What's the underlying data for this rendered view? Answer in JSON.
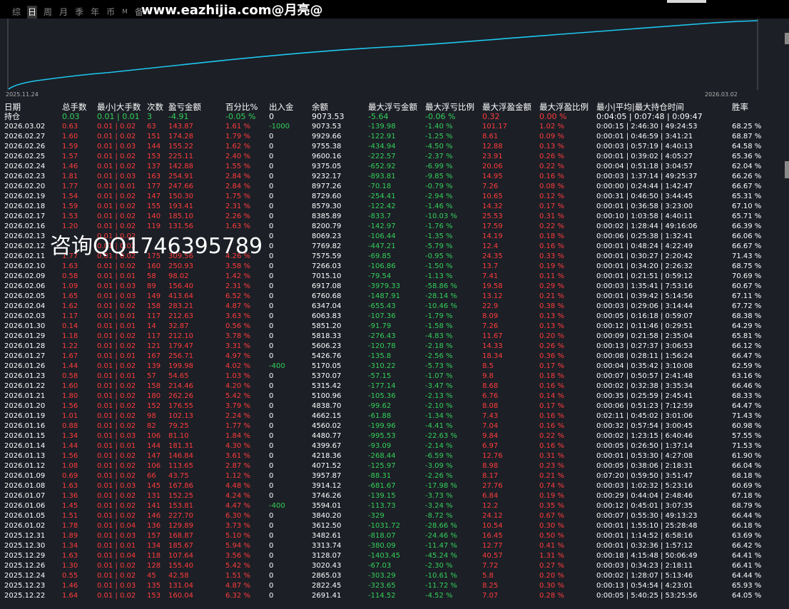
{
  "toolbar": {
    "tabs": [
      {
        "label": "综",
        "active": false
      },
      {
        "label": "日",
        "active": true
      },
      {
        "label": "周",
        "active": false
      },
      {
        "label": "月",
        "active": false
      },
      {
        "label": "季",
        "active": false
      },
      {
        "label": "年",
        "active": false
      },
      {
        "label": "币",
        "active": false
      },
      {
        "label": "M",
        "active": false,
        "small": true
      },
      {
        "label": "备",
        "active": false
      }
    ],
    "watermark": "www.eazhijia.com@月亮@"
  },
  "chart": {
    "start_date": "2025.11.24",
    "end_date": "2026.03.02",
    "line_color": "#1ec8f0"
  },
  "chart_data": {
    "type": "line",
    "x": [
      "2025.11.24",
      "2026.03.02"
    ],
    "series": [
      {
        "values": []
      }
    ]
  },
  "table": {
    "headers": {
      "date": "日期",
      "total": "总手数",
      "minmax": "最小|大手数",
      "count": "次数",
      "pl": "盈亏金额",
      "pct": "百分比%",
      "io": "出入金",
      "bal": "余额",
      "mdd": "最大浮亏金额",
      "mddp": "最大浮亏比例",
      "mfp": "最大浮盈金额",
      "mfpp": "最大浮盈比例",
      "time": "最小|平均|最大持仓时间",
      "win": "胜率"
    },
    "holding": {
      "date": "持仓",
      "total": "0.03",
      "minmax": "0.01 | 0.01",
      "count": "3",
      "pl": "-4.91",
      "pct": "-0.05 %",
      "io": "0",
      "bal": "9073.53",
      "mdd": "-5.64",
      "mddp": "-0.06 %",
      "mfp": "0.32",
      "mfpp": "0.00 %",
      "time": "0:04:05 | 0:07:48 | 0:09:47",
      "win": ""
    },
    "rows": [
      [
        "2026.03.02",
        "0.63",
        "0.01 | 0.02",
        "63",
        "143.87",
        "1.61 %",
        "-1000",
        "9073.53",
        "-139.98",
        "-1.40 %",
        "101.17",
        "1.02 %",
        "0:00:15 | 2:46:30 | 49:24:53",
        "68.25 %"
      ],
      [
        "2026.02.27",
        "1.60",
        "0.01 | 0.02",
        "151",
        "174.28",
        "1.79 %",
        "0",
        "9929.66",
        "-122.91",
        "-1.25 %",
        "8.61",
        "0.09 %",
        "0:00:01 | 0:46:59 | 3:41:21",
        "68.87 %"
      ],
      [
        "2026.02.26",
        "1.59",
        "0.01 | 0.03",
        "144",
        "155.22",
        "1.62 %",
        "0",
        "9755.38",
        "-434.94",
        "-4.50 %",
        "12.88",
        "0.13 %",
        "0:00:03 | 0:57:19 | 4:40:13",
        "64.58 %"
      ],
      [
        "2026.02.25",
        "1.57",
        "0.01 | 0.02",
        "153",
        "225.11",
        "2.40 %",
        "0",
        "9600.16",
        "-222.57",
        "-2.37 %",
        "23.91",
        "0.26 %",
        "0:00:01 | 0:39:02 | 4:05:27",
        "65.36 %"
      ],
      [
        "2026.02.24",
        "1.46",
        "0.01 | 0.02",
        "137",
        "142.88",
        "1.55 %",
        "0",
        "9375.05",
        "-652.92",
        "-6.99 %",
        "20.06",
        "0.22 %",
        "0:00:04 | 0:51:18 | 3:04:57",
        "62.04 %"
      ],
      [
        "2026.02.23",
        "1.81",
        "0.01 | 0.03",
        "163",
        "254.91",
        "2.84 %",
        "0",
        "9232.17",
        "-893.81",
        "-9.85 %",
        "14.95",
        "0.16 %",
        "0:00:03 | 1:37:14 | 49:25:37",
        "66.26 %"
      ],
      [
        "2026.02.20",
        "1.77",
        "0.01 | 0.01",
        "177",
        "247.66",
        "2.84 %",
        "0",
        "8977.26",
        "-70.18",
        "-0.79 %",
        "7.26",
        "0.08 %",
        "0:00:00 | 0:24:44 | 1:42:47",
        "66.67 %"
      ],
      [
        "2026.02.19",
        "1.54",
        "0.01 | 0.02",
        "147",
        "150.30",
        "1.75 %",
        "0",
        "8729.60",
        "-254.41",
        "-2.94 %",
        "10.65",
        "0.12 %",
        "0:00:31 | 0:46:50 | 3:44:45",
        "65.31 %"
      ],
      [
        "2026.02.18",
        "1.59",
        "0.01 | 0.02",
        "155",
        "193.41",
        "2.31 %",
        "0",
        "8579.30",
        "-122.42",
        "-1.46 %",
        "14.32",
        "0.17 %",
        "0:00:01 | 0:36:58 | 3:23:00",
        "67.10 %"
      ],
      [
        "2026.02.17",
        "1.53",
        "0.01 | 0.02",
        "140",
        "185.10",
        "2.26 %",
        "0",
        "8385.89",
        "-833.7",
        "-10.03 %",
        "25.53",
        "0.31 %",
        "0:00:10 | 1:03:58 | 4:40:11",
        "65.71 %"
      ],
      [
        "2026.02.16",
        "1.20",
        "0.01 | 0.02",
        "119",
        "131.56",
        "1.63 %",
        "0",
        "8200.79",
        "-142.97",
        "-1.76 %",
        "17.59",
        "0.22 %",
        "0:00:02 | 1:28:44 | 49:16:06",
        "66.39 %"
      ],
      [
        "2026.02.13",
        "",
        "0.01 | 0.02",
        "",
        "",
        "",
        "0",
        "8069.23",
        "-106.44",
        "-1.35 %",
        "14.19",
        "0.18 %",
        "0:00:06 | 0:25:38 | 1:32:41",
        "66.06 %"
      ],
      [
        "2026.02.12",
        "",
        "0.01 | 0.02",
        "",
        "",
        "",
        "0",
        "7769.82",
        "-447.21",
        "-5.79 %",
        "12.4",
        "0.16 %",
        "0:00:01 | 0:48:24 | 4:22:49",
        "66.67 %"
      ],
      [
        "2026.02.11",
        "1.77",
        "0.01 | 0.02",
        "175",
        "309.56",
        "4.26 %",
        "0",
        "7575.59",
        "-69.85",
        "-0.95 %",
        "24.35",
        "0.33 %",
        "0:00:01 | 0:30:27 | 2:20:42",
        "71.43 %"
      ],
      [
        "2026.02.10",
        "1.63",
        "0.01 | 0.02",
        "160",
        "250.93",
        "3.58 %",
        "0",
        "7266.03",
        "-106.86",
        "-1.50 %",
        "13.7",
        "0.19 %",
        "0:00:01 | 0:34:20 | 2:26:32",
        "68.75 %"
      ],
      [
        "2026.02.09",
        "0.58",
        "0.01 | 0.01",
        "58",
        "98.02",
        "1.42 %",
        "0",
        "7015.10",
        "-79.54",
        "-1.13 %",
        "7.41",
        "0.11 %",
        "0:00:01 | 0:21:51 | 0:59:12",
        "70.69 %"
      ],
      [
        "2026.02.06",
        "1.09",
        "0.01 | 0.03",
        "89",
        "156.40",
        "2.31 %",
        "0",
        "6917.08",
        "-3979.33",
        "-58.86 %",
        "19.58",
        "0.29 %",
        "0:00:03 | 1:35:41 | 7:53:16",
        "60.67 %"
      ],
      [
        "2026.02.05",
        "1.65",
        "0.01 | 0.03",
        "149",
        "413.64",
        "6.52 %",
        "0",
        "6760.68",
        "-1487.91",
        "-28.14 %",
        "13.12",
        "0.21 %",
        "0:00:01 | 0:39:42 | 5:14:56",
        "67.11 %"
      ],
      [
        "2026.02.04",
        "1.62",
        "0.01 | 0.02",
        "158",
        "283.21",
        "4.87 %",
        "0",
        "6347.04",
        "-655.43",
        "-10.46 %",
        "22.9",
        "0.38 %",
        "0:00:03 | 0:29:06 | 3:14:44",
        "67.72 %"
      ],
      [
        "2026.02.03",
        "1.17",
        "0.01 | 0.01",
        "117",
        "212.63",
        "3.63 %",
        "0",
        "6063.83",
        "-107.36",
        "-1.79 %",
        "8.09",
        "0.13 %",
        "0:00:05 | 0:16:18 | 0:59:07",
        "68.38 %"
      ],
      [
        "2026.01.30",
        "0.14",
        "0.01 | 0.01",
        "14",
        "32.87",
        "0.56 %",
        "0",
        "5851.20",
        "-91.79",
        "-1.58 %",
        "7.26",
        "0.13 %",
        "0:00:12 | 0:11:46 | 0:29:51",
        "64.29 %"
      ],
      [
        "2026.01.29",
        "1.18",
        "0.01 | 0.02",
        "117",
        "212.10",
        "3.78 %",
        "0",
        "5818.33",
        "-276.43",
        "-4.83 %",
        "11.67",
        "0.20 %",
        "0:00:09 | 0:21:58 | 2:35:04",
        "65.81 %"
      ],
      [
        "2026.01.28",
        "1.22",
        "0.01 | 0.02",
        "121",
        "179.47",
        "3.31 %",
        "0",
        "5606.23",
        "-120.78",
        "-2.18 %",
        "14.33",
        "0.26 %",
        "0:00:13 | 0:27:37 | 3:06:53",
        "66.12 %"
      ],
      [
        "2026.01.27",
        "1.67",
        "0.01 | 0.01",
        "167",
        "256.71",
        "4.97 %",
        "0",
        "5426.76",
        "-135.8",
        "-2.56 %",
        "18.34",
        "0.36 %",
        "0:00:08 | 0:28:11 | 1:56:24",
        "66.47 %"
      ],
      [
        "2026.01.26",
        "1.44",
        "0.01 | 0.02",
        "139",
        "199.98",
        "4.02 %",
        "-400",
        "5170.05",
        "-310.22",
        "-5.73 %",
        "8.5",
        "0.17 %",
        "0:00:04 | 0:35:42 | 3:10:08",
        "62.59 %"
      ],
      [
        "2026.01.23",
        "0.58",
        "0.01 | 0.01",
        "57",
        "54.65",
        "1.03 %",
        "0",
        "5370.07",
        "-57.15",
        "-1.07 %",
        "9.8",
        "0.18 %",
        "0:00:07 | 0:50:57 | 2:41:48",
        "63.16 %"
      ],
      [
        "2026.01.22",
        "1.60",
        "0.01 | 0.02",
        "158",
        "214.46",
        "4.20 %",
        "0",
        "5315.42",
        "-177.14",
        "-3.47 %",
        "8.68",
        "0.16 %",
        "0:00:02 | 0:32:38 | 3:35:34",
        "66.46 %"
      ],
      [
        "2026.01.21",
        "1.80",
        "0.01 | 0.02",
        "180",
        "262.26",
        "5.42 %",
        "0",
        "5100.96",
        "-105.36",
        "-2.13 %",
        "6.76",
        "0.14 %",
        "0:00:35 | 0:25:59 | 2:45:41",
        "68.33 %"
      ],
      [
        "2026.01.20",
        "1.56",
        "0.01 | 0.02",
        "152",
        "176.55",
        "3.79 %",
        "0",
        "4838.70",
        "-99.62",
        "-2.10 %",
        "8.08",
        "0.17 %",
        "0:00:06 | 0:51:23 | 7:12:59",
        "64.47 %"
      ],
      [
        "2026.01.19",
        "1.01",
        "0.01 | 0.02",
        "98",
        "102.13",
        "2.24 %",
        "0",
        "4662.15",
        "-61.88",
        "-1.34 %",
        "7.43",
        "0.16 %",
        "0:02:11 | 0:45:02 | 3:01:06",
        "71.43 %"
      ],
      [
        "2026.01.16",
        "0.88",
        "0.01 | 0.02",
        "82",
        "79.25",
        "1.77 %",
        "0",
        "4560.02",
        "-199.96",
        "-4.41 %",
        "7.04",
        "0.16 %",
        "0:00:32 | 0:57:54 | 3:00:45",
        "60.98 %"
      ],
      [
        "2026.01.15",
        "1.34",
        "0.01 | 0.03",
        "106",
        "81.10",
        "1.84 %",
        "0",
        "4480.77",
        "-995.53",
        "-22.63 %",
        "9.84",
        "0.22 %",
        "0:00:02 | 1:23:15 | 6:40:46",
        "57.55 %"
      ],
      [
        "2026.01.14",
        "1.44",
        "0.01 | 0.01",
        "144",
        "181.31",
        "4.30 %",
        "0",
        "4399.67",
        "-93.09",
        "-2.14 %",
        "6.97",
        "0.16 %",
        "0:00:05 | 0:26:50 | 1:37:14",
        "71.53 %"
      ],
      [
        "2026.01.13",
        "1.56",
        "0.01 | 0.02",
        "147",
        "146.84",
        "3.61 %",
        "0",
        "4218.36",
        "-268.44",
        "-6.59 %",
        "12.76",
        "0.31 %",
        "0:00:01 | 0:53:30 | 4:27:08",
        "61.90 %"
      ],
      [
        "2026.01.12",
        "1.08",
        "0.01 | 0.02",
        "106",
        "113.65",
        "2.87 %",
        "0",
        "4071.52",
        "-125.97",
        "-3.09 %",
        "8.98",
        "0.23 %",
        "0:00:05 | 0:38:06 | 2:18:31",
        "66.04 %"
      ],
      [
        "2026.01.09",
        "0.69",
        "0.01 | 0.02",
        "66",
        "43.75",
        "1.12 %",
        "0",
        "3957.87",
        "-88.31",
        "-2.26 %",
        "8.17",
        "0.21 %",
        "0:07:20 | 0:59:50 | 3:51:47",
        "68.18 %"
      ],
      [
        "2026.01.08",
        "1.63",
        "0.01 | 0.03",
        "145",
        "167.86",
        "4.48 %",
        "0",
        "3914.12",
        "-681.67",
        "-17.98 %",
        "27.76",
        "0.74 %",
        "0:00:03 | 1:02:32 | 5:23:16",
        "60.69 %"
      ],
      [
        "2026.01.07",
        "1.36",
        "0.01 | 0.02",
        "131",
        "152.25",
        "4.24 %",
        "0",
        "3746.26",
        "-139.15",
        "-3.73 %",
        "6.84",
        "0.19 %",
        "0:00:29 | 0:44:04 | 2:48:46",
        "67.18 %"
      ],
      [
        "2026.01.06",
        "1.45",
        "0.01 | 0.02",
        "141",
        "153.81",
        "4.47 %",
        "-400",
        "3594.01",
        "-113.73",
        "-3.24 %",
        "12.2",
        "0.35 %",
        "0:00:12 | 0:45:01 | 3:07:35",
        "68.79 %"
      ],
      [
        "2026.01.05",
        "1.51",
        "0.01 | 0.02",
        "146",
        "227.70",
        "6.30 %",
        "0",
        "3840.20",
        "-329",
        "-8.72 %",
        "24.12",
        "0.67 %",
        "0:00:07 | 0:55:30 | 49:13:23",
        "66.44 %"
      ],
      [
        "2026.01.02",
        "1.78",
        "0.01 | 0.04",
        "136",
        "129.89",
        "3.73 %",
        "0",
        "3612.50",
        "-1031.72",
        "-28.66 %",
        "10.54",
        "0.30 %",
        "0:00:01 | 1:55:10 | 25:28:48",
        "66.18 %"
      ],
      [
        "2025.12.31",
        "1.89",
        "0.01 | 0.03",
        "157",
        "168.87",
        "5.10 %",
        "0",
        "3482.61",
        "-818.07",
        "-24.46 %",
        "16.45",
        "0.50 %",
        "0:00:01 | 1:14:52 | 6:58:16",
        "63.69 %"
      ],
      [
        "2025.12.30",
        "1.34",
        "0.01 | 0.01",
        "134",
        "185.67",
        "5.94 %",
        "0",
        "3313.74",
        "-380.09",
        "-11.47 %",
        "12.77",
        "0.41 %",
        "0:00:01 | 0:32:36 | 1:57:12",
        "66.42 %"
      ],
      [
        "2025.12.29",
        "1.63",
        "0.01 | 0.04",
        "118",
        "107.64",
        "3.56 %",
        "0",
        "3128.07",
        "-1403.45",
        "-45.24 %",
        "40.57",
        "1.31 %",
        "0:00:18 | 4:15:48 | 50:06:49",
        "64.41 %"
      ],
      [
        "2025.12.26",
        "1.30",
        "0.01 | 0.02",
        "128",
        "155.40",
        "5.42 %",
        "0",
        "3020.43",
        "-67.03",
        "-2.30 %",
        "7.72",
        "0.27 %",
        "0:00:03 | 0:34:23 | 2:18:11",
        "66.41 %"
      ],
      [
        "2025.12.24",
        "0.55",
        "0.01 | 0.02",
        "45",
        "42.58",
        "1.51 %",
        "0",
        "2865.03",
        "-303.29",
        "-10.61 %",
        "5.8",
        "0.20 %",
        "0:00:02 | 1:28:07 | 5:13:46",
        "64.44 %"
      ],
      [
        "2025.12.23",
        "1.46",
        "0.01 | 0.03",
        "135",
        "131.04",
        "4.87 %",
        "0",
        "2822.45",
        "-323.65",
        "-11.72 %",
        "8.25",
        "0.30 %",
        "0:00:13 | 0:54:54 | 4:23:01",
        "65.93 %"
      ],
      [
        "2025.12.22",
        "1.64",
        "0.01 | 0.02",
        "153",
        "160.04",
        "6.32 %",
        "0",
        "2691.41",
        "-114.52",
        "-4.52 %",
        "7.07",
        "0.28 %",
        "0:00:05 | 5:40:25 | 53:25:56",
        "64.05 %"
      ]
    ]
  },
  "overlay": {
    "qq_watermark": "咨询QQ1746395789"
  },
  "colors": {
    "positive": "#ff3c3c",
    "negative": "#33d159",
    "text": "#ffffff",
    "background": "#1c1f26"
  }
}
